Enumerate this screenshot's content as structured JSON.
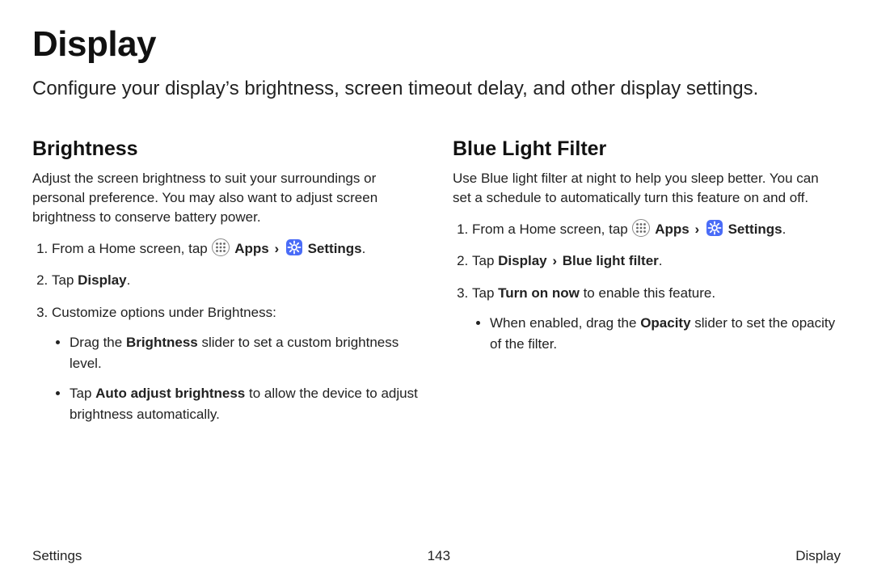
{
  "title": "Display",
  "intro": "Configure your display’s brightness, screen timeout delay, and other display settings.",
  "labels": {
    "apps": "Apps",
    "settings": "Settings",
    "display": "Display",
    "blue_light_filter": "Blue light filter",
    "turn_on_now": "Turn on now",
    "brightness_word": "Brightness",
    "auto_adjust": "Auto adjust brightness",
    "opacity": "Opacity"
  },
  "brightness": {
    "heading": "Brightness",
    "desc": "Adjust the screen brightness to suit your surroundings or personal preference. You may also want to adjust screen brightness to conserve battery power.",
    "step1_prefix": "From a Home screen, tap ",
    "step2_prefix": "Tap ",
    "step2_suffix": ".",
    "step3": "Customize options under Brightness:",
    "bullet1_a": "Drag the ",
    "bullet1_b": " slider to set a custom brightness level.",
    "bullet2_a": "Tap ",
    "bullet2_b": " to allow the device to adjust brightness automatically."
  },
  "bluelight": {
    "heading": "Blue Light Filter",
    "desc": "Use Blue light filter at night to help you sleep better. You can set a schedule to automatically turn this feature on and off.",
    "step1_prefix": "From a Home screen, tap ",
    "step2_prefix": "Tap ",
    "step2_suffix": ".",
    "step3_a": "Tap ",
    "step3_b": " to enable this feature.",
    "bullet1_a": "When enabled, drag the ",
    "bullet1_b": " slider to set the opacity of the filter."
  },
  "footer": {
    "left": "Settings",
    "center": "143",
    "right": "Display"
  }
}
